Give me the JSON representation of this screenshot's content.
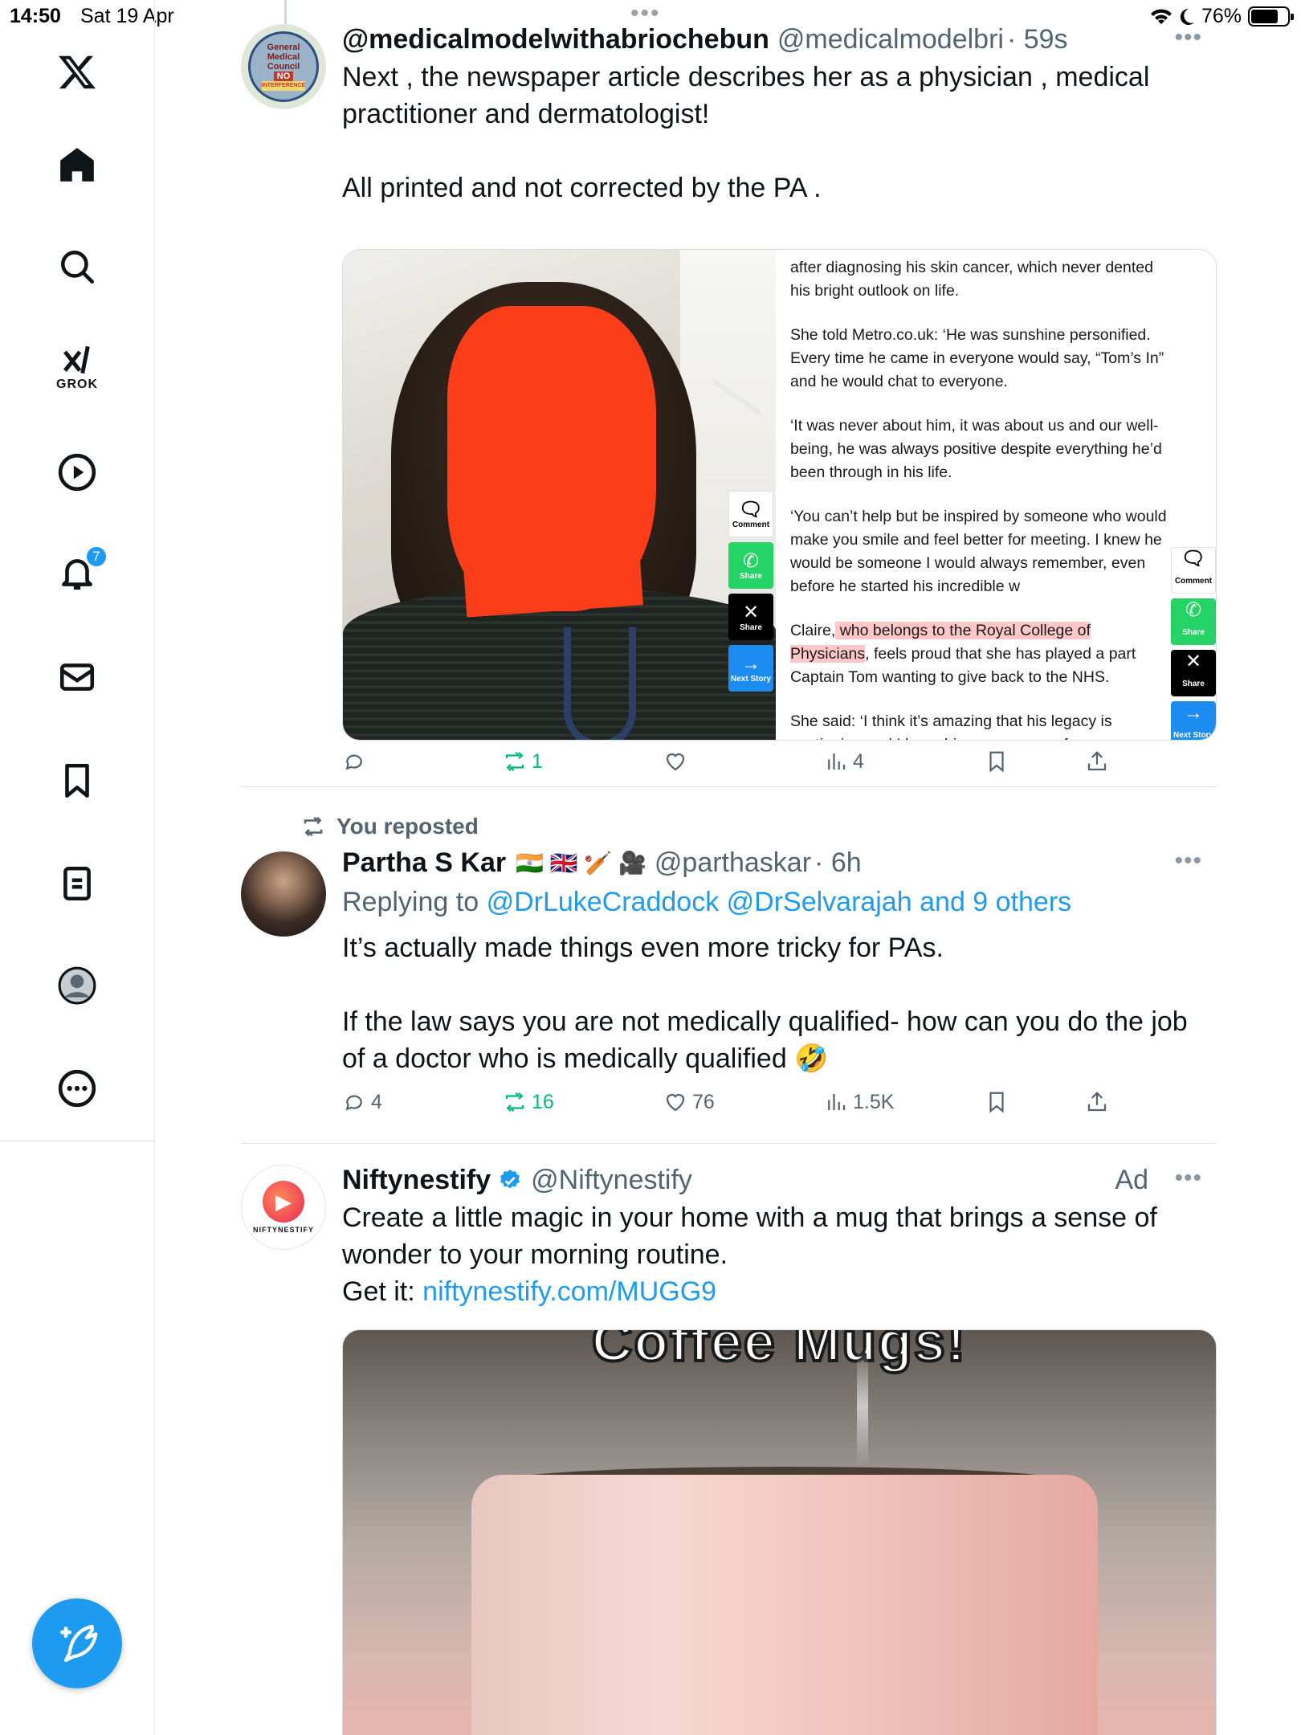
{
  "status_bar": {
    "time": "14:50",
    "date": "Sat 19 Apr",
    "battery": "76%",
    "battery_level": 0.76
  },
  "sidebar": {
    "items": [
      {
        "name": "home",
        "icon": "home-icon"
      },
      {
        "name": "explore",
        "icon": "search-icon"
      },
      {
        "name": "grok",
        "icon": "grok-icon",
        "label": "GROK"
      },
      {
        "name": "video",
        "icon": "play-icon"
      },
      {
        "name": "notifications",
        "icon": "bell-icon",
        "badge": "7"
      },
      {
        "name": "messages",
        "icon": "mail-icon"
      },
      {
        "name": "bookmarks",
        "icon": "bookmark-icon"
      },
      {
        "name": "lists",
        "icon": "list-icon"
      },
      {
        "name": "profile",
        "icon": "profile-icon"
      },
      {
        "name": "more",
        "icon": "more-circle-icon"
      }
    ],
    "compose": {
      "icon": "compose-icon"
    }
  },
  "posts": [
    {
      "name": "@medicalmodelwithabriochebun",
      "handle": "@medicalmodelbri",
      "time": "· 59s",
      "text": "Next , the newspaper article describes her as a physician , medical practitioner and dermatologist!\n\nAll printed and not corrected by the PA .",
      "avatar_text": [
        "General",
        "Medical",
        "Council",
        "NO",
        "INTERFERENCE"
      ],
      "media": {
        "share_buttons": [
          "Comment",
          "Share",
          "Share",
          "Next Story"
        ],
        "article_paragraphs": [
          "after diagnosing his skin cancer, which never dented his bright outlook on life.",
          "She told Metro.co.uk: ‘He was sunshine personified. Every time he came in everyone would say, “Tom’s In” and he would chat to everyone.",
          "‘It was never about him, it was about us and our well-being, he was always positive despite everything he’d been through in his life.",
          "‘You can’t help but be inspired by someone who would make you smile and feel better for meeting. I knew he would be someone I would always remember, even before he started his incredible w"
        ],
        "article_claire": {
          "start": "Claire,",
          "highlight": " who belongs to the Royal College of Physicians",
          "end": ", feels proud that she has played a part Captain Tom wanting to give back to the NHS."
        },
        "article_last": "She said: ‘I think it’s amazing that his legacy is continuing and I hope his memory may forever"
      },
      "stats": {
        "replies": "",
        "reposts": "1",
        "likes": "",
        "views": "4"
      }
    },
    {
      "repost_label": "You reposted",
      "name": "Partha S Kar",
      "name_emoji": "🇮🇳 🇬🇧 🏏 🎥",
      "handle": "@parthaskar",
      "time": "· 6h",
      "replying_prefix": "Replying to",
      "replying_to": "@DrLukeCraddock @DrSelvarajah and 9 others",
      "text": "It’s actually made things even more tricky for PAs.\n\nIf the law says you are not medically qualified- how can you do the job of a doctor who is medically qualified 🤣",
      "stats": {
        "replies": "4",
        "reposts": "16",
        "likes": "76",
        "views": "1.5K"
      }
    },
    {
      "name": "Niftynestify",
      "verified": true,
      "handle": "@Niftynestify",
      "ad_label": "Ad",
      "avatar_text": "NIFTYNESTIFY",
      "text": "Create a little magic in your home with a mug that brings a sense of wonder to your morning routine.",
      "cta_prefix": "Get it:",
      "cta_link": "niftynestify.com/MUGG9",
      "media_caption": "Coffee Mugs!"
    }
  ],
  "colors": {
    "accent": "#1d9bf0",
    "repost_green": "#00ba7c",
    "text": "#0f1419",
    "muted": "#536471",
    "redaction": "#fb3d1a"
  }
}
